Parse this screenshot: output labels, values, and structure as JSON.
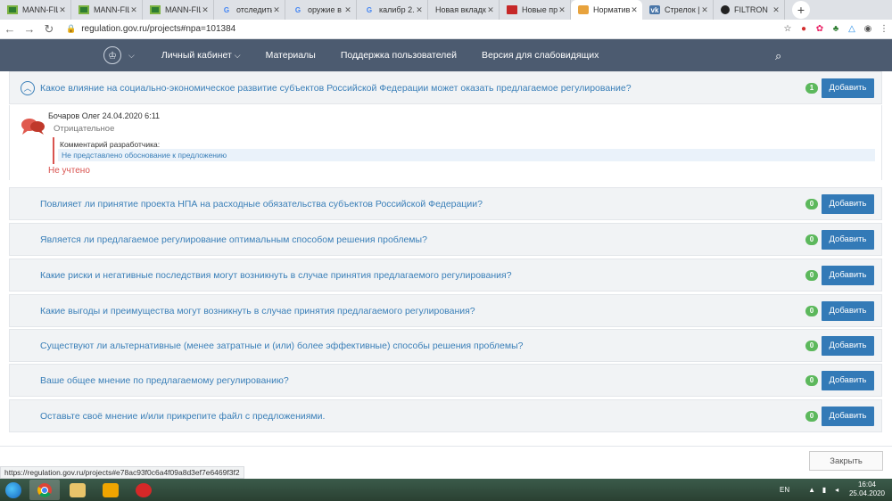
{
  "browser": {
    "tabs": [
      {
        "label": "MANN-FIL",
        "favicon": "spreadsheet-icon",
        "active": false
      },
      {
        "label": "MANN-FIL",
        "favicon": "spreadsheet-icon",
        "active": false
      },
      {
        "label": "MANN-FIL",
        "favicon": "spreadsheet-icon",
        "active": false
      },
      {
        "label": "отследить",
        "favicon": "google-icon",
        "active": false
      },
      {
        "label": "оружие в",
        "favicon": "google-icon",
        "active": false
      },
      {
        "label": "калибр 2.",
        "favicon": "google-icon",
        "active": false
      },
      {
        "label": "Новая вкладка",
        "favicon": "",
        "active": false
      },
      {
        "label": "Новые пр",
        "favicon": "document-icon",
        "active": false
      },
      {
        "label": "Норматив",
        "favicon": "shield-icon",
        "active": true
      },
      {
        "label": "Стрелок |",
        "favicon": "vk-icon",
        "active": false
      },
      {
        "label": "FILTRON",
        "favicon": "circle-icon",
        "active": false
      }
    ],
    "url": "regulation.gov.ru/projects#npa=101384",
    "status_url": "https://regulation.gov.ru/projects#e78ac93f0c6a4f09a8d3ef7e6469f3f2"
  },
  "site_nav": {
    "items": [
      "Личный кабинет",
      "Материалы",
      "Поддержка пользователей",
      "Версия для слабовидящих"
    ]
  },
  "questions": [
    {
      "text": "Какое влияние на социально-экономическое развитие субъектов Российской Федерации может оказать предлагаемое регулирование?",
      "count": "1",
      "add_label": "Добавить",
      "expanded": true
    },
    {
      "text": "Повлияет ли принятие проекта НПА на расходные обязательства субъектов Российской Федерации?",
      "count": "0",
      "add_label": "Добавить"
    },
    {
      "text": "Является ли предлагаемое регулирование оптимальным способом решения проблемы?",
      "count": "0",
      "add_label": "Добавить"
    },
    {
      "text": "Какие риски и негативные последствия могут возникнуть в случае принятия предлагаемого регулирования?",
      "count": "0",
      "add_label": "Добавить"
    },
    {
      "text": "Какие выгоды и преимущества могут возникнуть в случае принятия предлагаемого регулирования?",
      "count": "0",
      "add_label": "Добавить"
    },
    {
      "text": "Существуют ли альтернативные (менее затратные и (или) более эффективные) способы решения проблемы?",
      "count": "0",
      "add_label": "Добавить"
    },
    {
      "text": "Ваше общее мнение по предлагаемому регулированию?",
      "count": "0",
      "add_label": "Добавить"
    },
    {
      "text": "Оставьте своё мнение и/или прикрепите файл с предложениями.",
      "count": "0",
      "add_label": "Добавить"
    }
  ],
  "comment": {
    "author_date": "Бочаров Олег 24.04.2020 6:11",
    "verdict": "Отрицательное",
    "dev_label": "Комментарий разработчика:",
    "dev_text": "Не представлено обоснование к предложению",
    "status": "Не учтено"
  },
  "footer": {
    "close_label": "Закрыть"
  },
  "taskbar": {
    "lang": "EN",
    "time": "16:04",
    "date": "25.04.2020"
  },
  "colors": {
    "nav_bg": "#4c5b70",
    "link": "#3a7fb8",
    "button": "#337ab7",
    "badge": "#5cb85c",
    "negative": "#d9534f"
  }
}
